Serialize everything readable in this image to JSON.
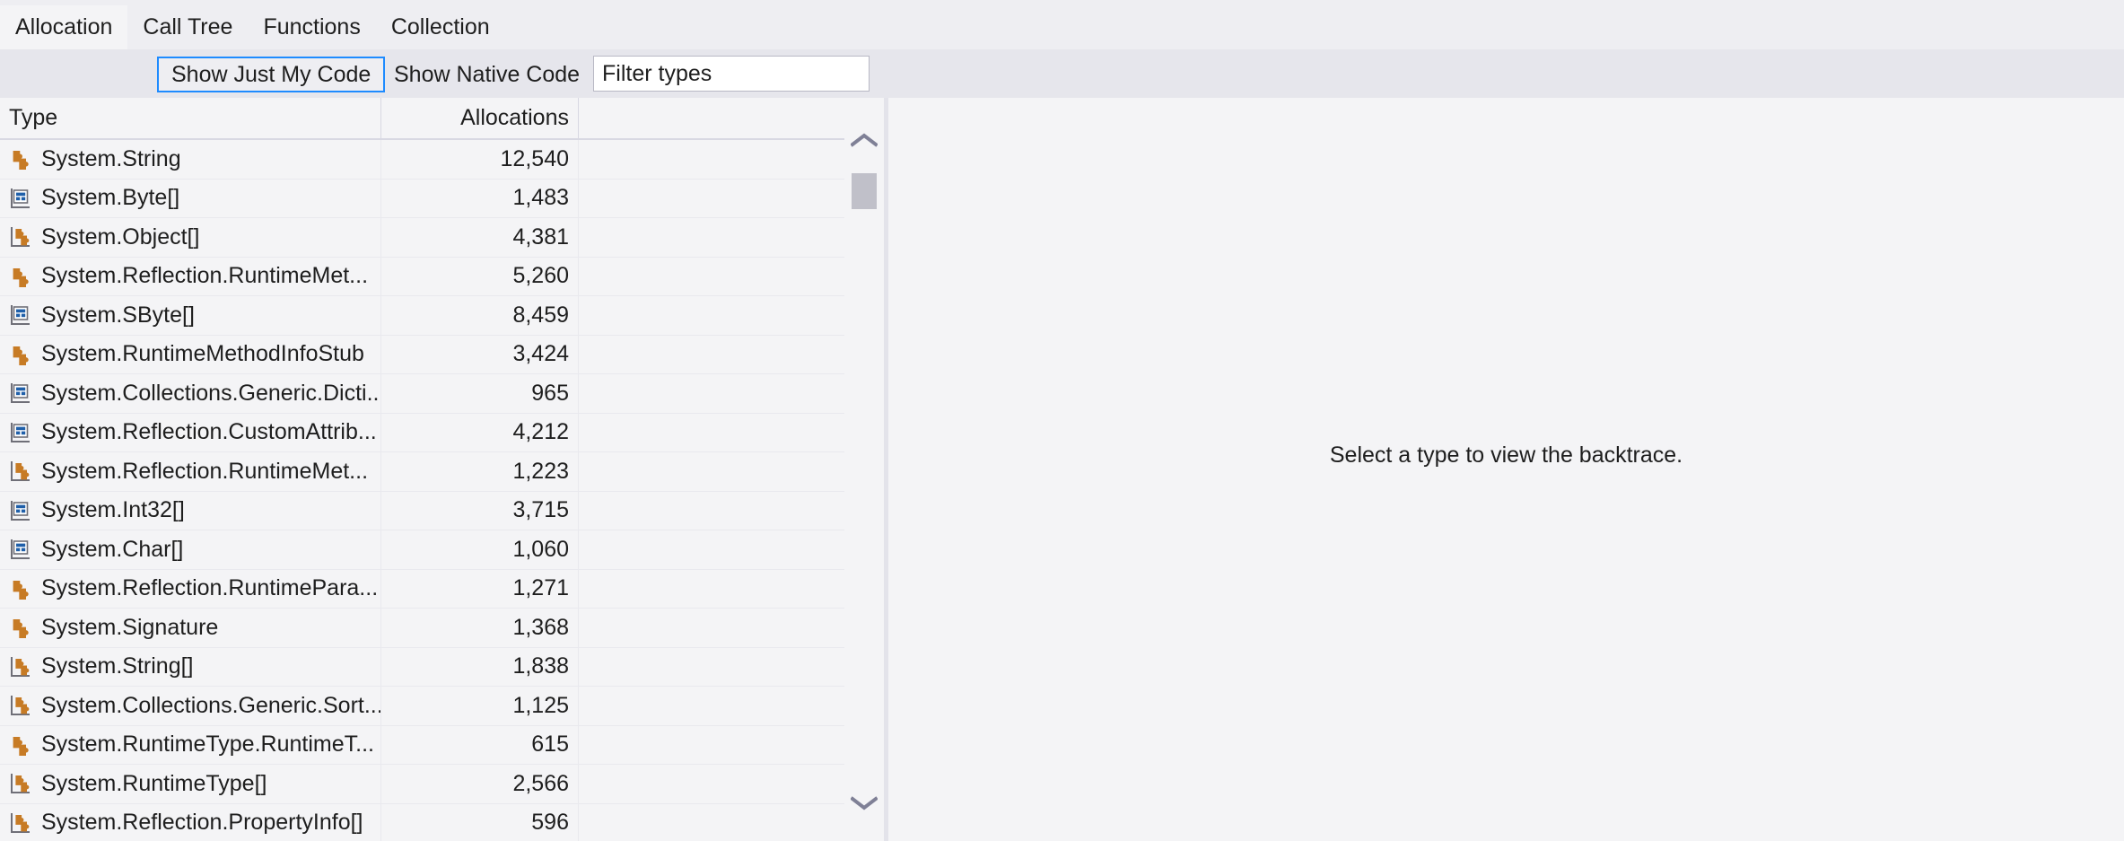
{
  "tabs": [
    {
      "label": "Allocation",
      "active": true
    },
    {
      "label": "Call Tree",
      "active": false
    },
    {
      "label": "Functions",
      "active": false
    },
    {
      "label": "Collection",
      "active": false
    }
  ],
  "toolbar": {
    "show_just_my_code": "Show Just My Code",
    "show_native_code": "Show Native Code",
    "filter_placeholder": "Filter types",
    "filter_value": ""
  },
  "grid": {
    "columns": [
      "Type",
      "Allocations",
      ""
    ],
    "rows": [
      {
        "type": "System.String",
        "allocations": "12,540",
        "icon": "class-icon"
      },
      {
        "type": "System.Byte[]",
        "allocations": "1,483",
        "icon": "value-array-icon"
      },
      {
        "type": "System.Object[]",
        "allocations": "4,381",
        "icon": "class-array-icon"
      },
      {
        "type": "System.Reflection.RuntimeMet...",
        "allocations": "5,260",
        "icon": "class-icon"
      },
      {
        "type": "System.SByte[]",
        "allocations": "8,459",
        "icon": "value-array-icon"
      },
      {
        "type": "System.RuntimeMethodInfoStub",
        "allocations": "3,424",
        "icon": "class-icon"
      },
      {
        "type": "System.Collections.Generic.Dicti...",
        "allocations": "965",
        "icon": "value-array-icon"
      },
      {
        "type": "System.Reflection.CustomAttrib...",
        "allocations": "4,212",
        "icon": "value-array-icon"
      },
      {
        "type": "System.Reflection.RuntimeMet...",
        "allocations": "1,223",
        "icon": "class-array-icon"
      },
      {
        "type": "System.Int32[]",
        "allocations": "3,715",
        "icon": "value-array-icon"
      },
      {
        "type": "System.Char[]",
        "allocations": "1,060",
        "icon": "value-array-icon"
      },
      {
        "type": "System.Reflection.RuntimePara...",
        "allocations": "1,271",
        "icon": "class-icon"
      },
      {
        "type": "System.Signature",
        "allocations": "1,368",
        "icon": "class-icon"
      },
      {
        "type": "System.String[]",
        "allocations": "1,838",
        "icon": "class-array-icon"
      },
      {
        "type": "System.Collections.Generic.Sort...",
        "allocations": "1,125",
        "icon": "class-array-icon"
      },
      {
        "type": "System.RuntimeType.RuntimeT...",
        "allocations": "615",
        "icon": "class-icon"
      },
      {
        "type": "System.RuntimeType[]",
        "allocations": "2,566",
        "icon": "class-array-icon"
      },
      {
        "type": "System.Reflection.PropertyInfo[]",
        "allocations": "596",
        "icon": "class-array-icon"
      }
    ]
  },
  "scrollbar": {
    "up_label": "chevron-up",
    "down_label": "chevron-down"
  },
  "right_panel": {
    "message": "Select a type to view the backtrace."
  },
  "colors": {
    "background": "#f4f4f6",
    "toolbar_background": "#e6e6ec",
    "tabstrip_background": "#eeeef2",
    "focus_border": "#1e8bff",
    "class_icon": "#c77b25",
    "value_icon": "#1f5fa9",
    "divider": "#e3e3ea",
    "scroll_thumb": "#c0c0c9"
  }
}
